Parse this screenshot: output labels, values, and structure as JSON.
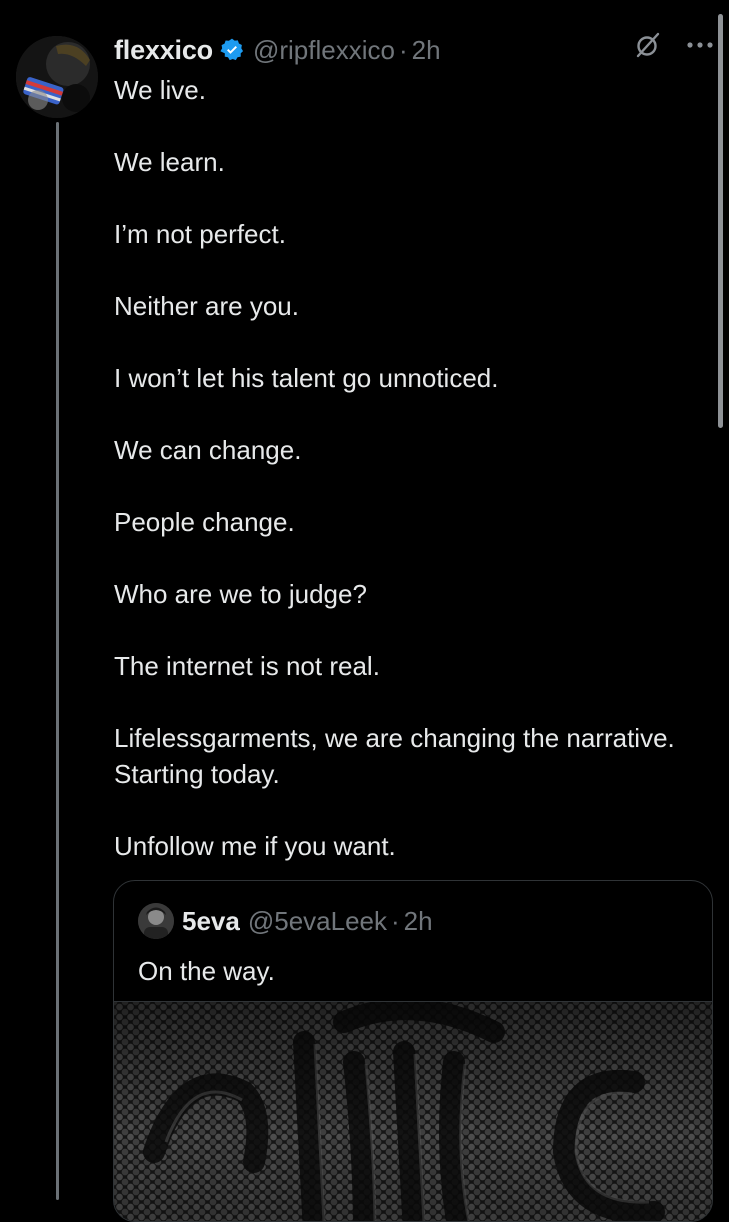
{
  "author": {
    "display_name": "flexxico",
    "handle": "@ripflexxico",
    "separator": "·",
    "time": "2h",
    "verified": true,
    "avatar_icon": "avatar-image"
  },
  "tweet": {
    "lines": [
      "We live.",
      "We learn.",
      "I’m not perfect.",
      "Neither are you.",
      "I won’t let his talent go unnoticed.",
      "We can change.",
      "People change.",
      "Who are we to judge?",
      "The internet is not real.",
      "Lifelessgarments, we are changing the narrative. Starting today.",
      "Unfollow me if you want."
    ]
  },
  "header_actions": {
    "grok_icon": "grok-icon",
    "more_icon": "more-icon"
  },
  "quote": {
    "display_name": "5eva",
    "handle": "@5evaLeek",
    "separator": "·",
    "time": "2h",
    "text": "On the way.",
    "media": "image"
  },
  "colors": {
    "background": "#000000",
    "text_primary": "#e7e9ea",
    "text_secondary": "#71767b",
    "verified_blue": "#1d9bf0",
    "border": "#2f3336",
    "thread_line": "#6b7176"
  }
}
